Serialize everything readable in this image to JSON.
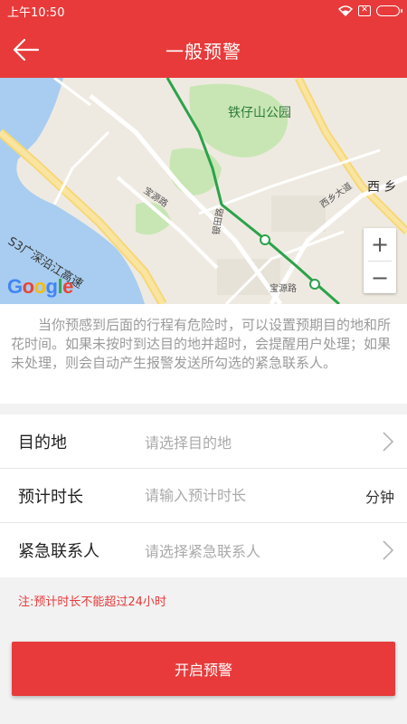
{
  "status_bar": {
    "time": "上午10:50",
    "sim_text": "✕"
  },
  "header": {
    "title": "一般预警",
    "back_icon": "arrow-left-icon"
  },
  "map": {
    "labels": {
      "park": "铁仔山公园",
      "xixiang": "西 乡",
      "highway": "S3广深沿江高速",
      "baoyuan_road": "宝源路",
      "yintian_road": "银田路",
      "xixiang_avenue": "西乡大道",
      "baoyuan_road_2": "宝源路"
    },
    "logo_letters": [
      "G",
      "o",
      "o",
      "g",
      "l",
      "e"
    ],
    "zoom_in": "+",
    "zoom_out": "−"
  },
  "description": "当你预感到后面的行程有危险时，可以设置预期目的地和所花时间。如果未按时到达目的地并超时，会提醒用户处理；如果未处理，则会自动产生报警发送所勾选的紧急联系人。",
  "form": {
    "destination": {
      "label": "目的地",
      "placeholder": "请选择目的地"
    },
    "duration": {
      "label": "预计时长",
      "placeholder": "请输入预计时长",
      "value": "",
      "unit": "分钟"
    },
    "contact": {
      "label": "紧急联系人",
      "placeholder": "请选择紧急联系人"
    }
  },
  "note": "注:预计时长不能超过24小时",
  "submit_label": "开启预警",
  "colors": {
    "primary": "#e83a3a",
    "water": "#a8cdf0",
    "park": "#c8e6b4",
    "route": "#2aa34a",
    "google_blue": "#4285f4",
    "google_red": "#ea4335",
    "google_yellow": "#fbbc05",
    "google_green": "#34a853"
  }
}
